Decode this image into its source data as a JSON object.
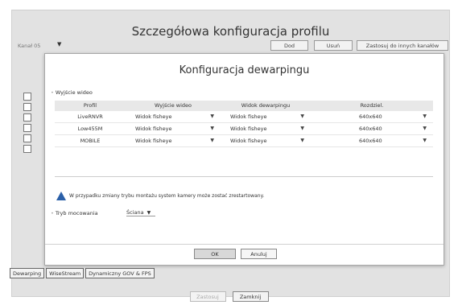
{
  "outer": {
    "title": "Szczegółowa konfiguracja profilu",
    "channel_label": "Kanał 05",
    "channel_arrow": "▼",
    "buttons": {
      "add": "Dod",
      "remove": "Usuń",
      "apply": "Zastosuj do innych kanałów"
    },
    "bottom_tabs": [
      "Dewarping",
      "WiseStream",
      "Dynamiczny GOV & FPS"
    ],
    "footer": {
      "apply": "Zastosuj",
      "close": "Zamknij"
    }
  },
  "modal": {
    "title": "Konfiguracja dewarpingu",
    "section_label": "Wyjście wideo",
    "columns": {
      "profile": "Profil",
      "video_out": "Wyjście wideo",
      "dewarp_view": "Widok dewarpingu",
      "resolution": "Rozdziel."
    },
    "rows": [
      {
        "profile": "LiveRNVR",
        "video_out": "Widok fisheye",
        "dewarp_view": "Widok fisheye",
        "resolution": "640x640"
      },
      {
        "profile": "Low455M",
        "video_out": "Widok fisheye",
        "dewarp_view": "Widok fisheye",
        "resolution": "640x640"
      },
      {
        "profile": "MOBILE",
        "video_out": "Widok fisheye",
        "dewarp_view": "Widok fisheye",
        "resolution": "640x640"
      }
    ],
    "dropdown_arrow": "▼",
    "warning": "W przypadku zmiany trybu montażu system kamery może zostać zrestartowany.",
    "mount_label": "Tryb mocowania",
    "mount_value": "Ściana",
    "ok": "OK",
    "cancel": "Anuluj"
  },
  "colors": {
    "warning_icon": "#2a5fa8",
    "backdrop": "#e2e2e2"
  },
  "icons": {
    "warning": "warning-triangle-icon",
    "dropdown": "chevron-down-icon"
  }
}
